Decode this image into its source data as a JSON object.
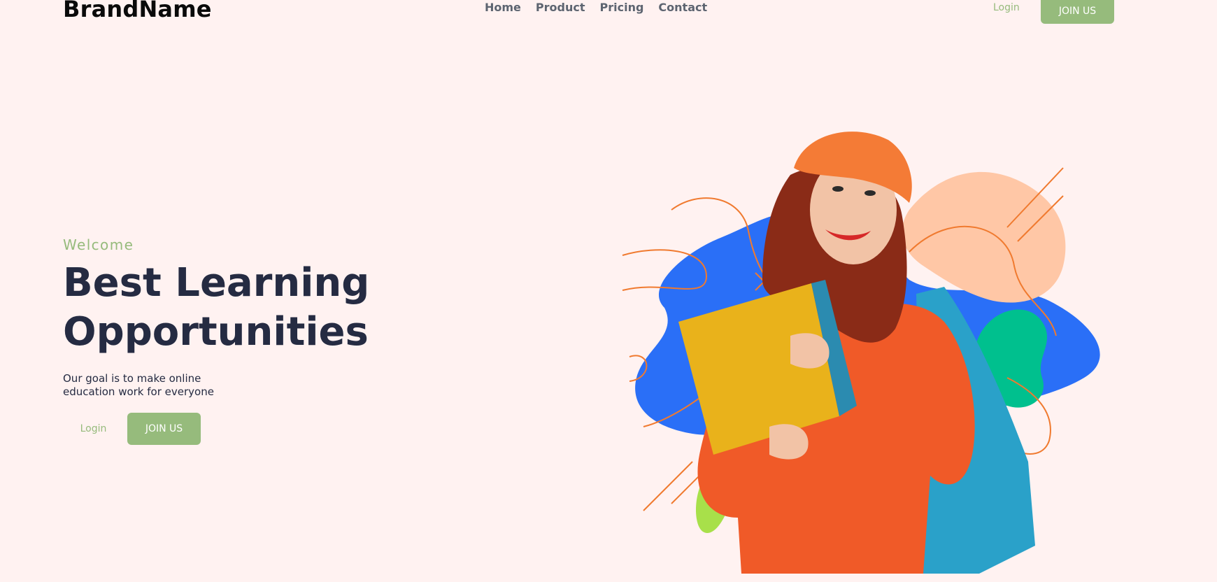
{
  "nav": {
    "brand": "BrandName",
    "links": [
      "Home",
      "Product",
      "Pricing",
      "Contact"
    ],
    "login": "Login",
    "join": "JOIN US"
  },
  "hero": {
    "welcome": "Welcome",
    "title_line1": "Best Learning",
    "title_line2": "Opportunities",
    "desc_line1": "Our goal is to make online",
    "desc_line2": "education work for everyone",
    "login": "Login",
    "join": "JOIN US"
  },
  "colors": {
    "background": "#fff2f1",
    "accent": "#96bb7c",
    "heading": "#252b42",
    "blob_blue": "#2a6ff7",
    "blob_peach": "#ffc7a6",
    "blob_green": "#00c08e",
    "sweater": "#f05a28",
    "folder": "#e9b21b"
  },
  "icons": {
    "hero_image": "student-with-books-illustration"
  }
}
